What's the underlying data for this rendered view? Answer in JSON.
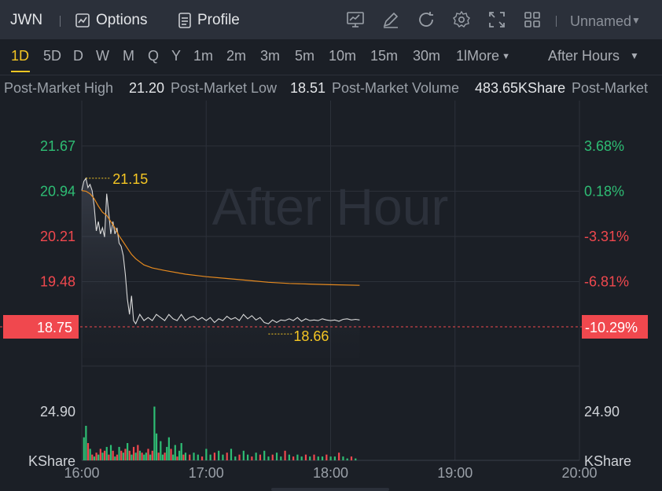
{
  "header": {
    "ticker": "JWN",
    "options_label": "Options",
    "profile_label": "Profile",
    "layout_name": "Unnamed"
  },
  "periods": [
    "1D",
    "5D",
    "D",
    "W",
    "M",
    "Q",
    "Y",
    "1m",
    "2m",
    "3m",
    "5m",
    "10m",
    "15m",
    "30m",
    "1lMore"
  ],
  "active_period": "1D",
  "session_select": "After Hours",
  "stats": {
    "high_label": "Post-Market High",
    "high_value": "21.20",
    "low_label": "Post-Market Low",
    "low_value": "18.51",
    "volume_label": "Post-Market Volume",
    "volume_value": "483.65KShare",
    "trailing_label": "Post-Market"
  },
  "colors": {
    "up": "#2ebd74",
    "down": "#f0484e",
    "price_line": "#d9d9d9",
    "avg_line": "#e68a1f",
    "highlight": "#f5c623"
  },
  "chart_data": {
    "type": "line",
    "watermark": "After Hour",
    "x_ticks": [
      "16:00",
      "17:00",
      "18:00",
      "19:00",
      "20:00"
    ],
    "y_left_ticks": [
      "21.67",
      "20.94",
      "20.21",
      "19.48"
    ],
    "y_right_ticks": [
      "3.68%",
      "0.18%",
      "-3.31%",
      "-6.81%"
    ],
    "reference_price": "18.75",
    "reference_pct": "-10.29%",
    "high_marker": "21.15",
    "low_marker": "18.66",
    "volume_tick": "24.90",
    "volume_unit": "KShare",
    "ylim": [
      18.75,
      22.1
    ],
    "xlim_minutes": [
      0,
      240
    ],
    "volume_max": 45,
    "price_series": [
      [
        0,
        20.95
      ],
      [
        1,
        21.1
      ],
      [
        2,
        21.15
      ],
      [
        3,
        21.0
      ],
      [
        4,
        21.05
      ],
      [
        5,
        20.95
      ],
      [
        6,
        20.7
      ],
      [
        7,
        20.3
      ],
      [
        8,
        20.45
      ],
      [
        9,
        20.25
      ],
      [
        10,
        20.35
      ],
      [
        11,
        20.2
      ],
      [
        12,
        20.9
      ],
      [
        13,
        20.6
      ],
      [
        14,
        20.25
      ],
      [
        15,
        20.45
      ],
      [
        16,
        20.25
      ],
      [
        17,
        20.35
      ],
      [
        18,
        20.1
      ],
      [
        19,
        20.05
      ],
      [
        20,
        19.9
      ],
      [
        21,
        19.6
      ],
      [
        22,
        19.2
      ],
      [
        23,
        18.95
      ],
      [
        24,
        19.25
      ],
      [
        25,
        18.85
      ],
      [
        26,
        18.8
      ],
      [
        28,
        18.95
      ],
      [
        30,
        18.85
      ],
      [
        32,
        18.9
      ],
      [
        34,
        18.85
      ],
      [
        36,
        18.95
      ],
      [
        38,
        18.9
      ],
      [
        40,
        18.85
      ],
      [
        42,
        18.95
      ],
      [
        44,
        18.88
      ],
      [
        46,
        18.85
      ],
      [
        48,
        18.95
      ],
      [
        50,
        18.85
      ],
      [
        52,
        18.9
      ],
      [
        54,
        18.92
      ],
      [
        56,
        18.86
      ],
      [
        58,
        18.9
      ],
      [
        60,
        18.85
      ],
      [
        62,
        18.9
      ],
      [
        64,
        18.82
      ],
      [
        66,
        18.88
      ],
      [
        68,
        18.85
      ],
      [
        70,
        18.92
      ],
      [
        72,
        18.87
      ],
      [
        74,
        18.9
      ],
      [
        76,
        18.85
      ],
      [
        78,
        18.95
      ],
      [
        80,
        18.88
      ],
      [
        82,
        18.93
      ],
      [
        84,
        18.86
      ],
      [
        86,
        18.9
      ],
      [
        88,
        18.82
      ],
      [
        90,
        18.8
      ],
      [
        92,
        18.86
      ],
      [
        94,
        18.82
      ],
      [
        96,
        18.86
      ],
      [
        98,
        18.85
      ],
      [
        100,
        18.88
      ],
      [
        102,
        18.85
      ],
      [
        104,
        18.9
      ],
      [
        106,
        18.84
      ],
      [
        108,
        18.88
      ],
      [
        110,
        18.85
      ],
      [
        112,
        18.86
      ],
      [
        114,
        18.85
      ],
      [
        116,
        18.88
      ],
      [
        118,
        18.86
      ],
      [
        120,
        18.85
      ],
      [
        122,
        18.86
      ],
      [
        124,
        18.84
      ],
      [
        126,
        18.87
      ],
      [
        128,
        18.88
      ],
      [
        130,
        18.86
      ],
      [
        132,
        18.87
      ],
      [
        134,
        18.86
      ]
    ],
    "avg_series": [
      [
        0,
        20.95
      ],
      [
        2,
        20.94
      ],
      [
        4,
        20.9
      ],
      [
        6,
        20.82
      ],
      [
        8,
        20.7
      ],
      [
        10,
        20.6
      ],
      [
        12,
        20.55
      ],
      [
        14,
        20.45
      ],
      [
        16,
        20.35
      ],
      [
        18,
        20.22
      ],
      [
        20,
        20.12
      ],
      [
        22,
        20.02
      ],
      [
        24,
        19.92
      ],
      [
        26,
        19.85
      ],
      [
        28,
        19.8
      ],
      [
        30,
        19.75
      ],
      [
        34,
        19.7
      ],
      [
        40,
        19.66
      ],
      [
        50,
        19.6
      ],
      [
        60,
        19.56
      ],
      [
        70,
        19.53
      ],
      [
        80,
        19.5
      ],
      [
        90,
        19.47
      ],
      [
        100,
        19.45
      ],
      [
        110,
        19.44
      ],
      [
        120,
        19.43
      ],
      [
        134,
        19.42
      ]
    ],
    "volume_bars": [
      [
        1,
        12,
        "up"
      ],
      [
        2,
        18,
        "up"
      ],
      [
        3,
        9,
        "down"
      ],
      [
        4,
        6,
        "up"
      ],
      [
        5,
        3,
        "down"
      ],
      [
        6,
        2,
        "up"
      ],
      [
        7,
        4,
        "down"
      ],
      [
        8,
        3,
        "up"
      ],
      [
        9,
        6,
        "down"
      ],
      [
        10,
        4,
        "up"
      ],
      [
        11,
        5,
        "down"
      ],
      [
        12,
        7,
        "up"
      ],
      [
        13,
        3,
        "down"
      ],
      [
        14,
        8,
        "up"
      ],
      [
        15,
        5,
        "down"
      ],
      [
        16,
        2,
        "up"
      ],
      [
        17,
        3,
        "down"
      ],
      [
        18,
        7,
        "up"
      ],
      [
        19,
        5,
        "down"
      ],
      [
        20,
        4,
        "up"
      ],
      [
        21,
        6,
        "down"
      ],
      [
        22,
        9,
        "up"
      ],
      [
        23,
        5,
        "down"
      ],
      [
        24,
        3,
        "up"
      ],
      [
        25,
        7,
        "down"
      ],
      [
        26,
        4,
        "up"
      ],
      [
        27,
        8,
        "down"
      ],
      [
        28,
        5,
        "up"
      ],
      [
        29,
        4,
        "down"
      ],
      [
        30,
        3,
        "up"
      ],
      [
        31,
        4,
        "up"
      ],
      [
        32,
        6,
        "down"
      ],
      [
        33,
        3,
        "up"
      ],
      [
        34,
        5,
        "down"
      ],
      [
        35,
        28,
        "up"
      ],
      [
        36,
        14,
        "up"
      ],
      [
        37,
        4,
        "down"
      ],
      [
        38,
        10,
        "up"
      ],
      [
        39,
        3,
        "up"
      ],
      [
        40,
        4,
        "down"
      ],
      [
        41,
        7,
        "up"
      ],
      [
        42,
        12,
        "up"
      ],
      [
        43,
        6,
        "down"
      ],
      [
        44,
        3,
        "up"
      ],
      [
        45,
        8,
        "up"
      ],
      [
        46,
        2,
        "down"
      ],
      [
        47,
        5,
        "up"
      ],
      [
        48,
        9,
        "up"
      ],
      [
        49,
        3,
        "down"
      ],
      [
        50,
        4,
        "up"
      ],
      [
        52,
        3,
        "down"
      ],
      [
        54,
        4,
        "up"
      ],
      [
        56,
        3,
        "up"
      ],
      [
        58,
        2,
        "down"
      ],
      [
        60,
        6,
        "up"
      ],
      [
        62,
        3,
        "up"
      ],
      [
        64,
        4,
        "down"
      ],
      [
        66,
        5,
        "up"
      ],
      [
        68,
        3,
        "up"
      ],
      [
        70,
        4,
        "down"
      ],
      [
        72,
        6,
        "up"
      ],
      [
        74,
        2,
        "up"
      ],
      [
        76,
        3,
        "down"
      ],
      [
        78,
        5,
        "up"
      ],
      [
        80,
        3,
        "up"
      ],
      [
        82,
        2,
        "down"
      ],
      [
        84,
        4,
        "up"
      ],
      [
        86,
        3,
        "down"
      ],
      [
        88,
        5,
        "up"
      ],
      [
        90,
        2,
        "up"
      ],
      [
        92,
        3,
        "down"
      ],
      [
        94,
        4,
        "up"
      ],
      [
        96,
        2,
        "up"
      ],
      [
        98,
        5,
        "down"
      ],
      [
        100,
        3,
        "up"
      ],
      [
        102,
        2,
        "down"
      ],
      [
        104,
        3,
        "up"
      ],
      [
        106,
        2,
        "up"
      ],
      [
        108,
        3,
        "down"
      ],
      [
        110,
        2,
        "up"
      ],
      [
        112,
        3,
        "down"
      ],
      [
        114,
        2,
        "up"
      ],
      [
        116,
        2,
        "up"
      ],
      [
        118,
        3,
        "down"
      ],
      [
        120,
        2,
        "up"
      ],
      [
        122,
        2,
        "up"
      ],
      [
        124,
        4,
        "down"
      ],
      [
        126,
        2,
        "up"
      ],
      [
        128,
        1,
        "up"
      ],
      [
        130,
        2,
        "down"
      ],
      [
        132,
        1,
        "up"
      ]
    ]
  }
}
